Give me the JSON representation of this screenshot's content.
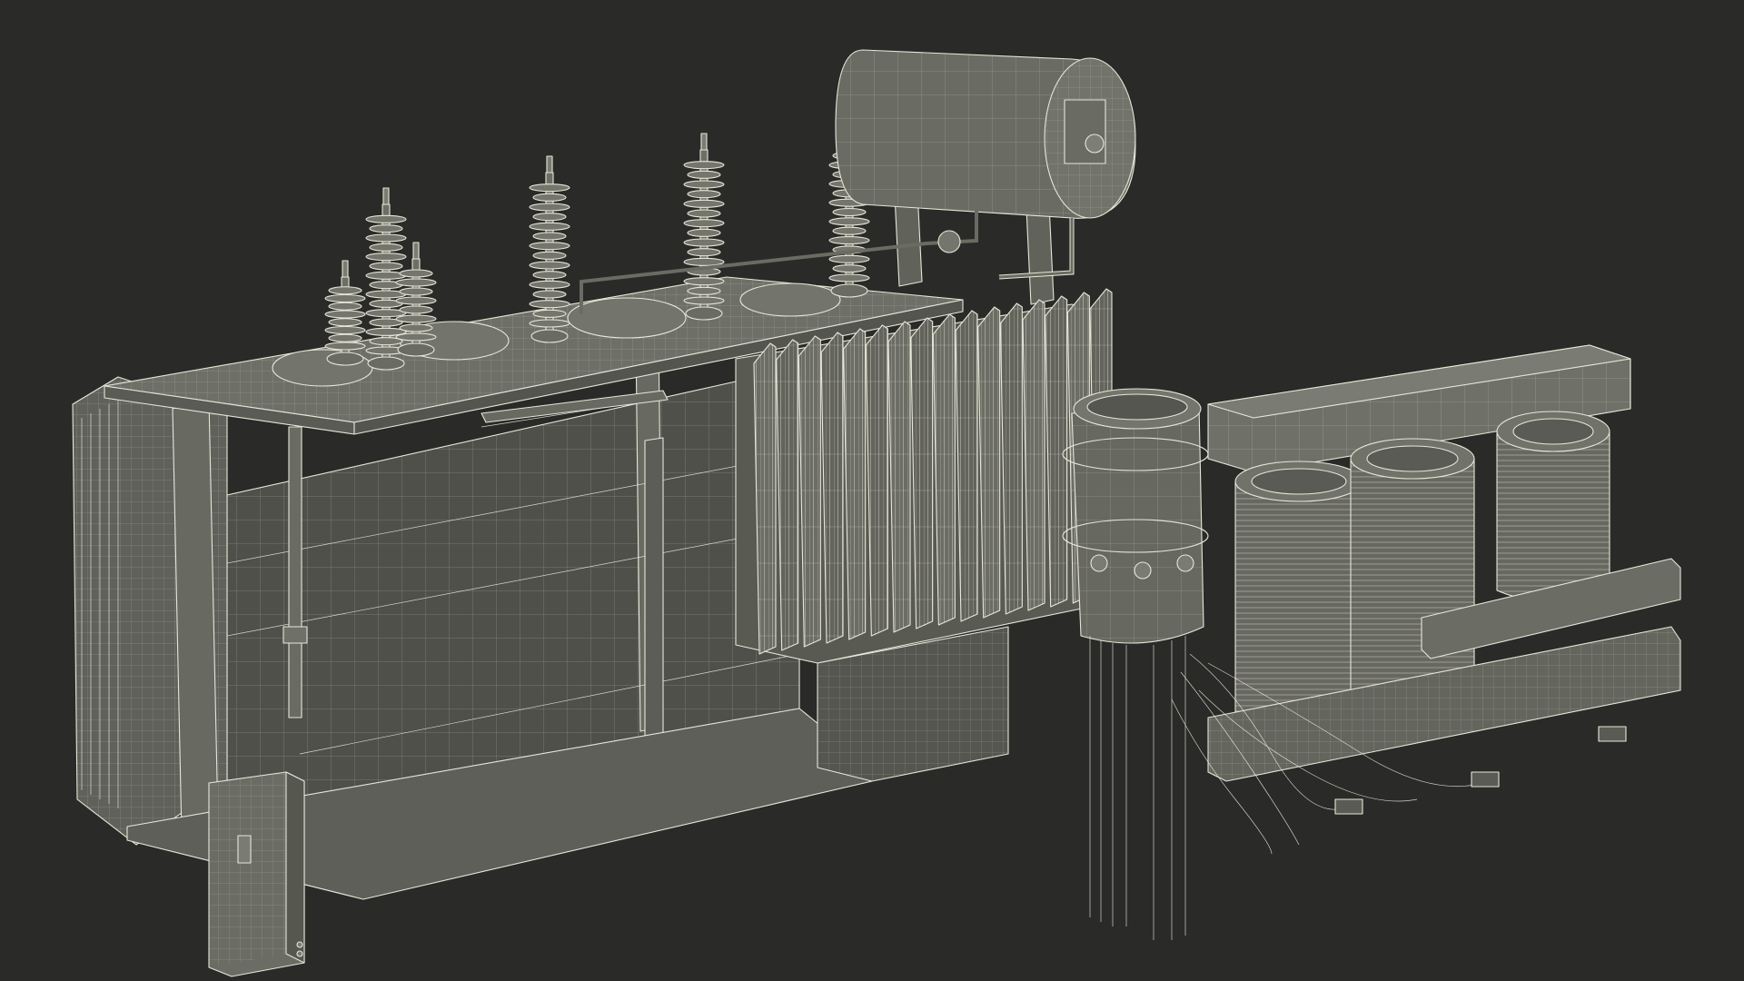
{
  "scene": {
    "subject": "power-transformer-wireframe",
    "colors": {
      "background": "#2a2a28",
      "surface": "#5d5e56",
      "surface_light": "#6b6c63",
      "surface_dark": "#4a4b44",
      "wire": "#f0eee2"
    },
    "bushings": 6,
    "radiator_fins": 16,
    "coil_columns": 3
  }
}
